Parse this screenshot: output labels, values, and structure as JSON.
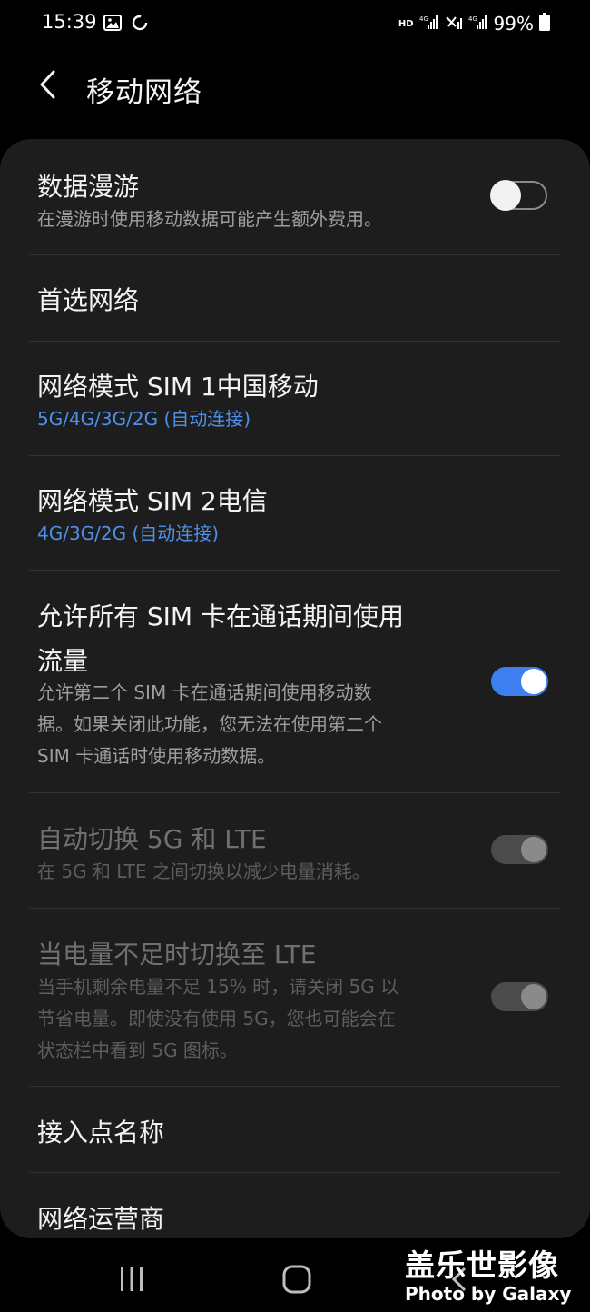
{
  "status_bar": {
    "time": "15:39",
    "gallery_icon": "gallery-icon",
    "sync_icon": "sync-icon",
    "hd_label": "HD",
    "battery_percent": "99%"
  },
  "header": {
    "back_icon": "chevron-left-icon",
    "title": "移动网络"
  },
  "settings": {
    "data_roaming": {
      "title": "数据漫游",
      "subtitle": "在漫游时使用移动数据可能产生额外费用。",
      "enabled": false
    },
    "preferred_network": {
      "title": "首选网络"
    },
    "network_mode_sim1": {
      "title": "网络模式 SIM 1中国移动",
      "value": "5G/4G/3G/2G (自动连接)"
    },
    "network_mode_sim2": {
      "title": "网络模式 SIM 2电信",
      "value": "4G/3G/2G (自动连接)"
    },
    "data_during_calls": {
      "title_line1": "允许所有 SIM 卡在通话期间使用",
      "title_line2": "流量",
      "subtitle_line1": "允许第二个 SIM 卡在通话期间使用移动数",
      "subtitle_line2": "据。如果关闭此功能，您无法在使用第二个",
      "subtitle_line3": "SIM 卡通话时使用移动数据。",
      "enabled": true
    },
    "auto_switch_5g_lte": {
      "title": "自动切换 5G 和 LTE",
      "subtitle": "在 5G 和 LTE 之间切换以减少电量消耗。",
      "enabled": true,
      "disabled": true
    },
    "low_battery_lte": {
      "title": "当电量不足时切换至 LTE",
      "subtitle_line1": "当手机剩余电量不足 15% 时，请关闭 5G 以",
      "subtitle_line2": "节省电量。即使没有使用 5G，您也可能会在",
      "subtitle_line3": "状态栏中看到 5G 图标。",
      "enabled": true,
      "disabled": true
    },
    "access_point_names": {
      "title": "接入点名称"
    },
    "network_operators": {
      "title": "网络运营商"
    }
  },
  "colors": {
    "accent": "#3d7ff0",
    "link_text": "#4f8fe9",
    "card_background": "#1d1d1d"
  },
  "watermark": {
    "title": "盖乐世影像",
    "subtitle": "Photo by Galaxy"
  }
}
